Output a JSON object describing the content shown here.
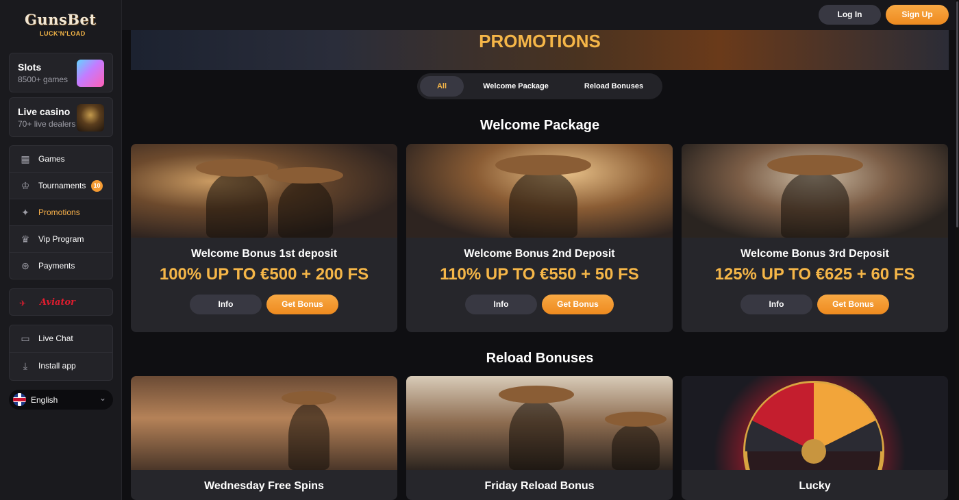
{
  "brand": {
    "name": "GunsBet",
    "tagline": "LUCK'N'LOAD"
  },
  "header": {
    "login_label": "Log In",
    "signup_label": "Sign Up"
  },
  "sidebar": {
    "features": [
      {
        "title": "Slots",
        "subtitle": "8500+ games"
      },
      {
        "title": "Live casino",
        "subtitle": "70+ live dealers"
      }
    ],
    "nav": [
      {
        "label": "Games",
        "icon": "games-icon"
      },
      {
        "label": "Tournaments",
        "icon": "trophy-icon",
        "badge": "10"
      },
      {
        "label": "Promotions",
        "icon": "promotions-icon",
        "active": true
      },
      {
        "label": "Vip Program",
        "icon": "vip-icon"
      },
      {
        "label": "Payments",
        "icon": "payments-icon"
      }
    ],
    "aviator": "Aviator",
    "extra": [
      {
        "label": "Live Chat",
        "icon": "chat-icon"
      },
      {
        "label": "Install app",
        "icon": "download-icon"
      }
    ],
    "language": "English"
  },
  "main": {
    "page_title": "PROMOTIONS",
    "tabs": [
      {
        "label": "All",
        "active": true
      },
      {
        "label": "Welcome Package"
      },
      {
        "label": "Reload Bonuses"
      }
    ],
    "sections": [
      {
        "title": "Welcome Package",
        "promos": [
          {
            "title": "Welcome Bonus 1st deposit",
            "value": "100% UP TO €500 + 200 FS",
            "info_label": "Info",
            "cta_label": "Get Bonus"
          },
          {
            "title": "Welcome Bonus 2nd Deposit",
            "value": "110% UP TO €550 + 50 FS",
            "info_label": "Info",
            "cta_label": "Get Bonus"
          },
          {
            "title": "Welcome Bonus 3rd Deposit",
            "value": "125% UP TO €625 + 60 FS",
            "info_label": "Info",
            "cta_label": "Get Bonus"
          }
        ]
      },
      {
        "title": "Reload Bonuses",
        "promos": [
          {
            "title": "Wednesday Free Spins"
          },
          {
            "title": "Friday Reload Bonus"
          },
          {
            "title": "Lucky"
          }
        ]
      }
    ]
  },
  "colors": {
    "accent": "#f5b648",
    "button_orange": "#f29a33",
    "card_bg": "#26262b",
    "page_bg": "#0f0f12"
  }
}
